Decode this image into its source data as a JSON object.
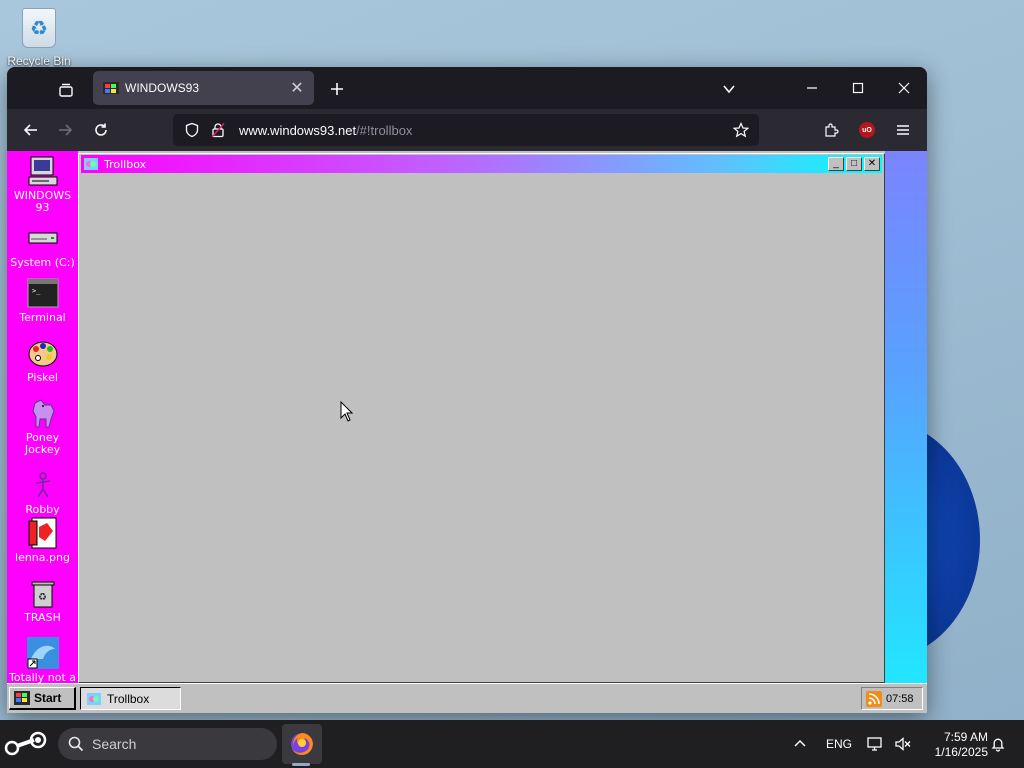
{
  "desktop": {
    "recycle_bin_label": "Recycle Bin"
  },
  "browser": {
    "tab": {
      "title": "WINDOWS93"
    },
    "url": {
      "host": "www.windows93.net",
      "path": "/#!trollbox"
    }
  },
  "w93": {
    "desktop_icons": [
      {
        "label": "WINDOWS 93"
      },
      {
        "label": "System (C:)"
      },
      {
        "label": "Terminal"
      },
      {
        "label": "Piskel"
      },
      {
        "label": "Poney Jockey"
      },
      {
        "label": "Robby"
      },
      {
        "label": "lenna.png"
      },
      {
        "label": "TRASH"
      },
      {
        "label": "Totally not a"
      }
    ],
    "trollbox": {
      "title": "Trollbox",
      "min_glyph": "_",
      "max_glyph": "□",
      "close_glyph": "✕"
    },
    "taskbar": {
      "start_label": "Start",
      "task_label": "Trollbox",
      "clock": "07:58"
    },
    "colors": {
      "desktop_bg": "#ff00ff",
      "window_gray": "#c0c0c0"
    }
  },
  "taskbar": {
    "search_label": "Search",
    "lang": "ENG",
    "time": "7:59 AM",
    "date": "1/16/2025"
  }
}
